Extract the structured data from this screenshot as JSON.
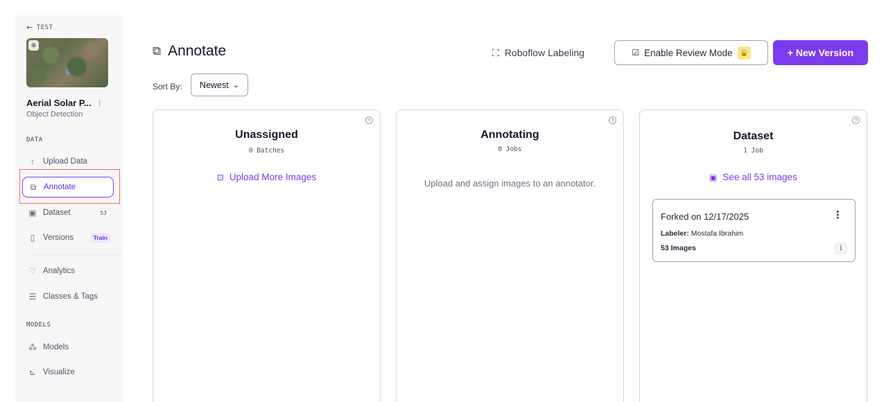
{
  "sidebar": {
    "back_label": "TEST",
    "project_name": "Aerial Solar P...",
    "project_type": "Object Detection",
    "section_data": "DATA",
    "section_models": "MODELS",
    "items": [
      {
        "label": "Upload Data",
        "icon": "upload-icon"
      },
      {
        "label": "Annotate",
        "icon": "annotate-icon",
        "active": true
      },
      {
        "label": "Dataset",
        "icon": "image-icon",
        "badge": "53"
      },
      {
        "label": "Versions",
        "icon": "versions-icon",
        "badge": "Train"
      },
      {
        "label": "Analytics",
        "icon": "analytics-icon"
      },
      {
        "label": "Classes & Tags",
        "icon": "list-icon"
      },
      {
        "label": "Models",
        "icon": "models-icon"
      },
      {
        "label": "Visualize",
        "icon": "chart-icon"
      }
    ]
  },
  "header": {
    "title": "Annotate",
    "roboflow_labeling": "Roboflow Labeling",
    "review_mode": "Enable Review Mode",
    "new_version": "+ New Version"
  },
  "sort": {
    "label": "Sort By:",
    "value": "Newest"
  },
  "columns": {
    "unassigned": {
      "title": "Unassigned",
      "subtitle": "0 Batches",
      "link": "Upload More Images"
    },
    "annotating": {
      "title": "Annotating",
      "subtitle": "0 Jobs",
      "empty": "Upload and assign images to an annotator."
    },
    "dataset": {
      "title": "Dataset",
      "subtitle": "1 Job",
      "link": "See all 53 images",
      "job": {
        "title": "Forked on 12/17/2025",
        "labeler_key": "Labeler:",
        "labeler_value": "Mostafa Ibrahim",
        "count": "53 Images"
      }
    }
  },
  "colors": {
    "accent": "#7c3aed",
    "highlight": "#ef6f6f",
    "lock": "#fde68a"
  }
}
